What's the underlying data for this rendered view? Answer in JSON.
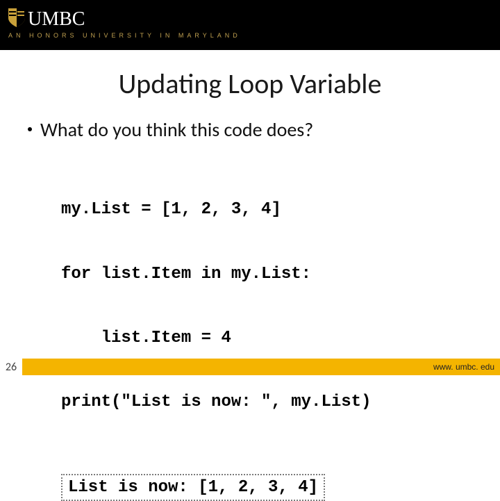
{
  "header": {
    "logo_text": "UMBC",
    "tagline": "AN HONORS UNIVERSITY IN MARYLAND"
  },
  "title": "Updating Loop Variable",
  "bullet": "What do you think this code does?",
  "code_lines": [
    "my.List = [1, 2, 3, 4]",
    "for list.Item in my.List:",
    "    list.Item = 4",
    "print(\"List is now: \", my.List)"
  ],
  "output": "List is now: [1, 2, 3, 4]",
  "footer": {
    "page_number": "26",
    "url": "www. umbc. edu"
  }
}
